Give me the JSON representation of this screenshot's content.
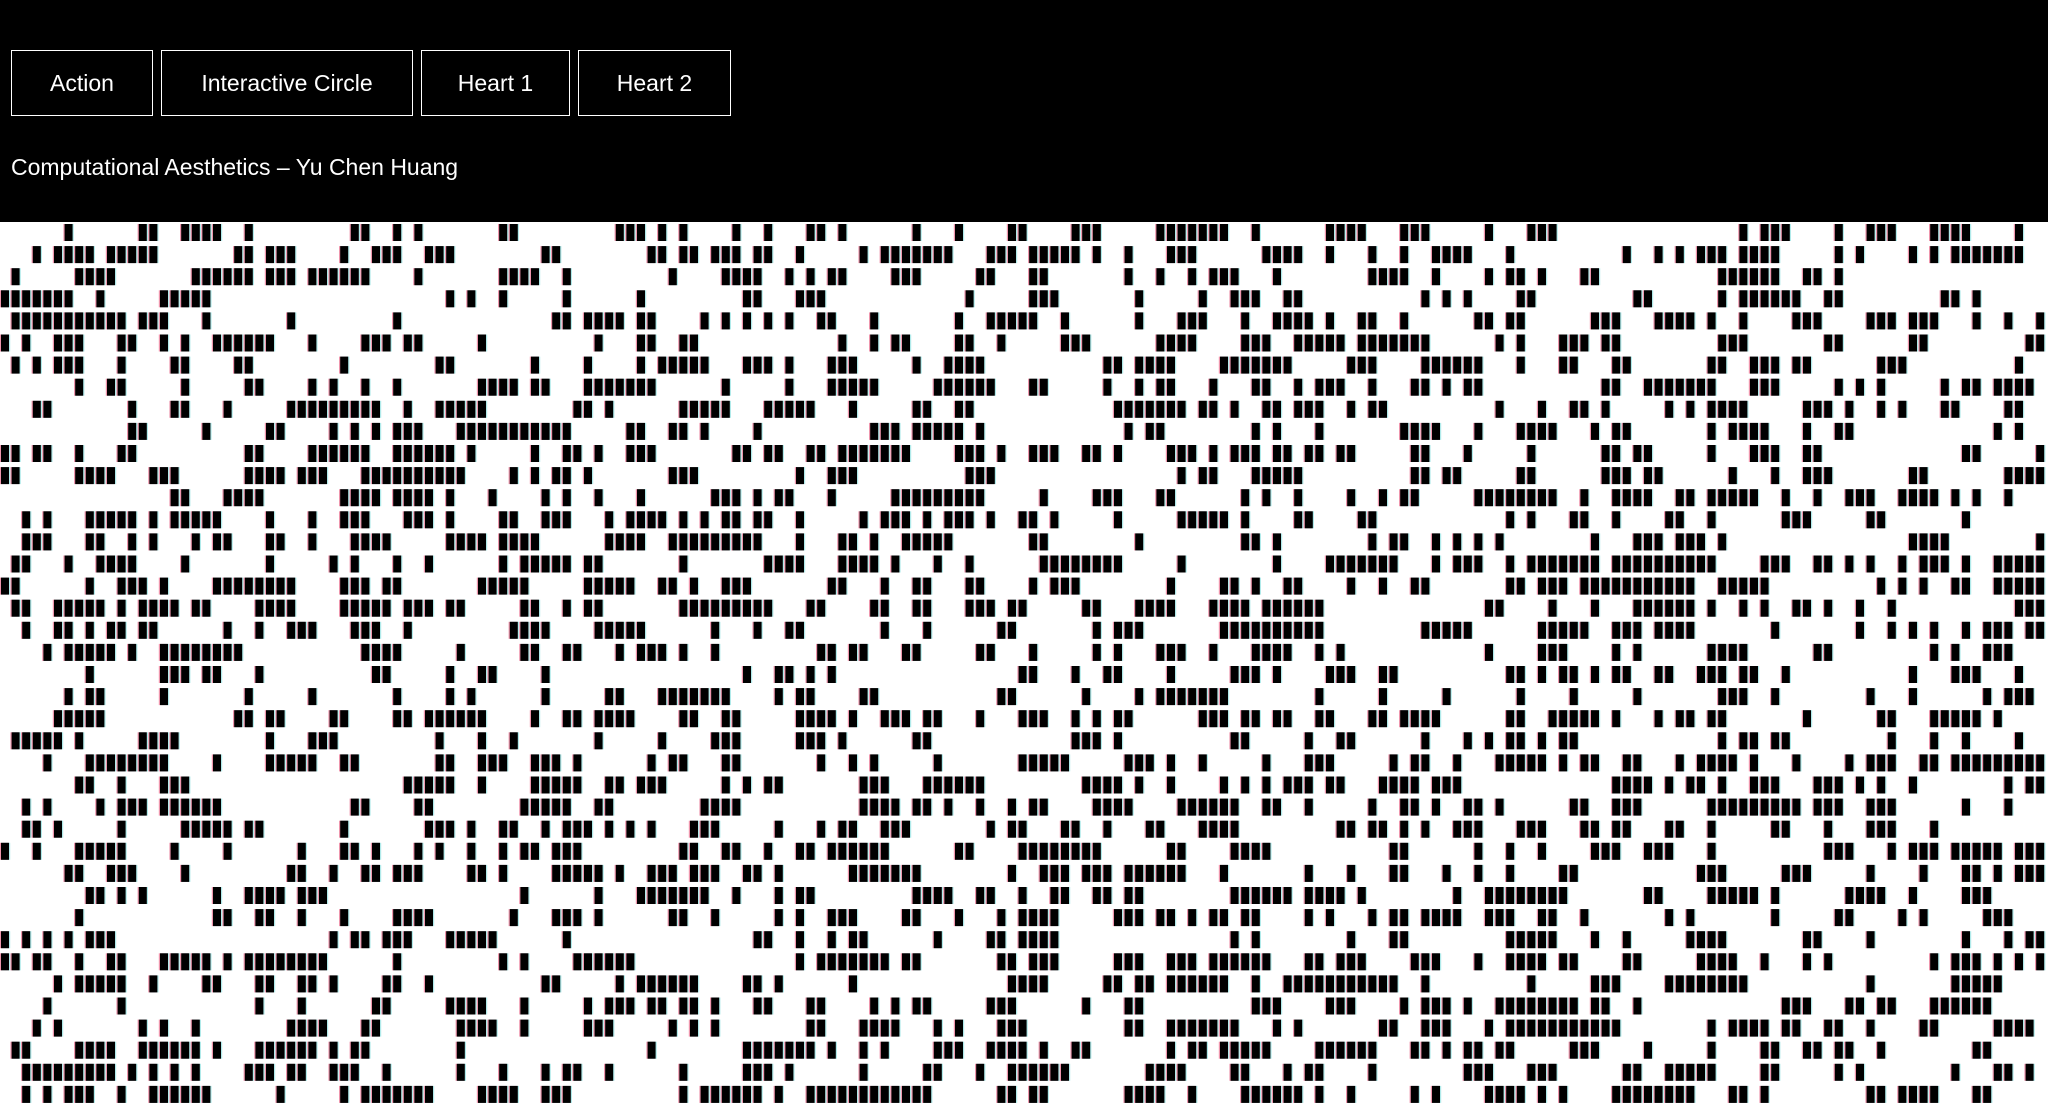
{
  "nav": {
    "items": [
      {
        "label": "Action"
      },
      {
        "label": "Interactive Circle"
      },
      {
        "label": "Heart 1"
      },
      {
        "label": "Heart 2"
      }
    ]
  },
  "subtitle": "Computational Aesthetics – Yu Chen Huang",
  "colors": {
    "header_bg": "#000000",
    "text": "#ffffff",
    "canvas_bg": "#ffffff",
    "mark_fill": "#000000",
    "mark_fringe_red": "#e0406a",
    "mark_fringe_cyan": "#6fd8d8"
  }
}
